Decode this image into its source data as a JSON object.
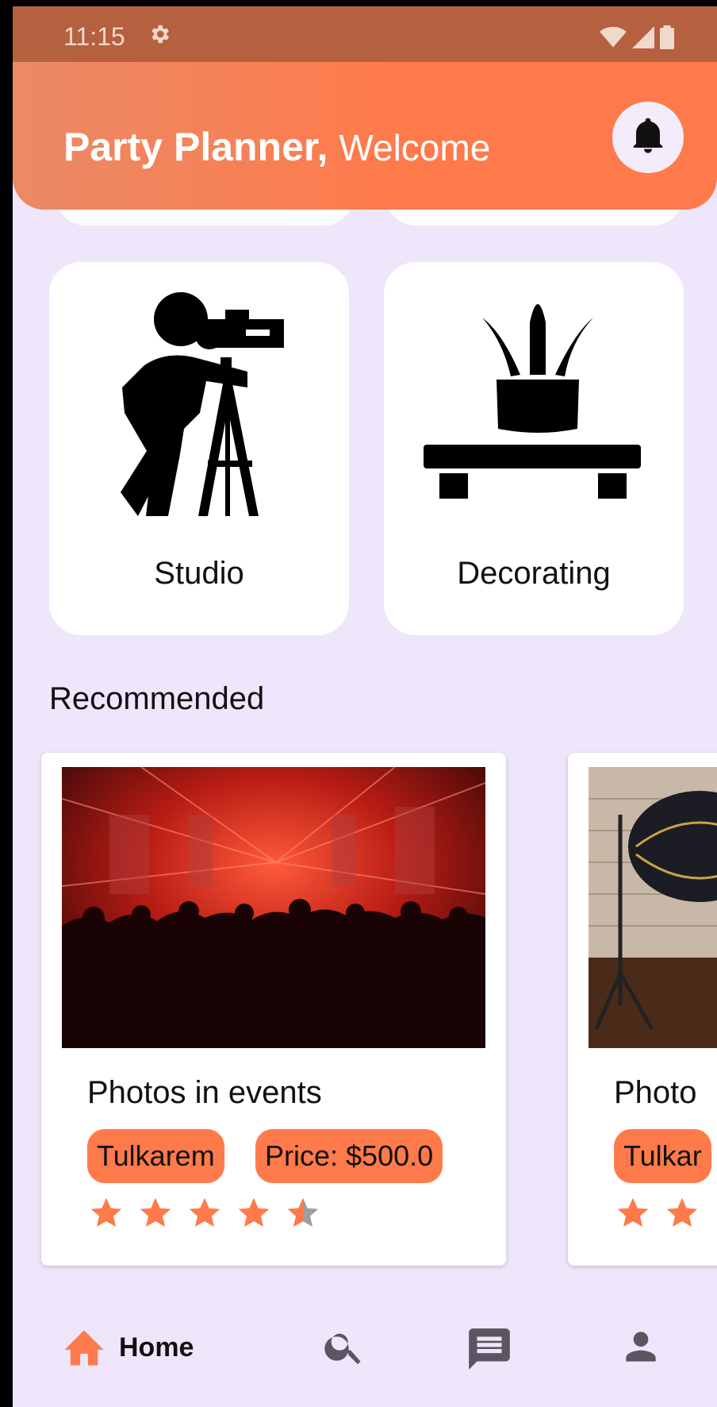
{
  "status_bar": {
    "time": "11:15",
    "icons": [
      "gear-icon",
      "wifi-icon",
      "signal-icon",
      "battery-icon"
    ]
  },
  "header": {
    "brand": "Party Planner,",
    "welcome": "Welcome",
    "notification_icon": "bell-icon",
    "gradient_colors": [
      "#ea8a66",
      "#ff7a4b"
    ]
  },
  "categories": [
    {
      "label": "Studio",
      "icon": "photographer-icon"
    },
    {
      "label": "Decorating",
      "icon": "plant-shelf-icon"
    }
  ],
  "recommended": {
    "title": "Recommended",
    "items": [
      {
        "title": "Photos in events",
        "location": "Tulkarem",
        "price": "Price: $500.0",
        "rating": 4.5
      },
      {
        "title": "Photo",
        "location": "Tulkar",
        "rating": 2
      }
    ]
  },
  "bottom_nav": {
    "items": [
      {
        "label": "Home",
        "icon": "home-icon",
        "active": true
      },
      {
        "label": "",
        "icon": "search-icon"
      },
      {
        "label": "",
        "icon": "chat-icon"
      },
      {
        "label": "",
        "icon": "profile-icon"
      }
    ]
  },
  "colors": {
    "accent": "#ff7a4b",
    "background": "#efe6fb",
    "star": "#ff7a4b",
    "star_empty": "#9e9e9e"
  }
}
